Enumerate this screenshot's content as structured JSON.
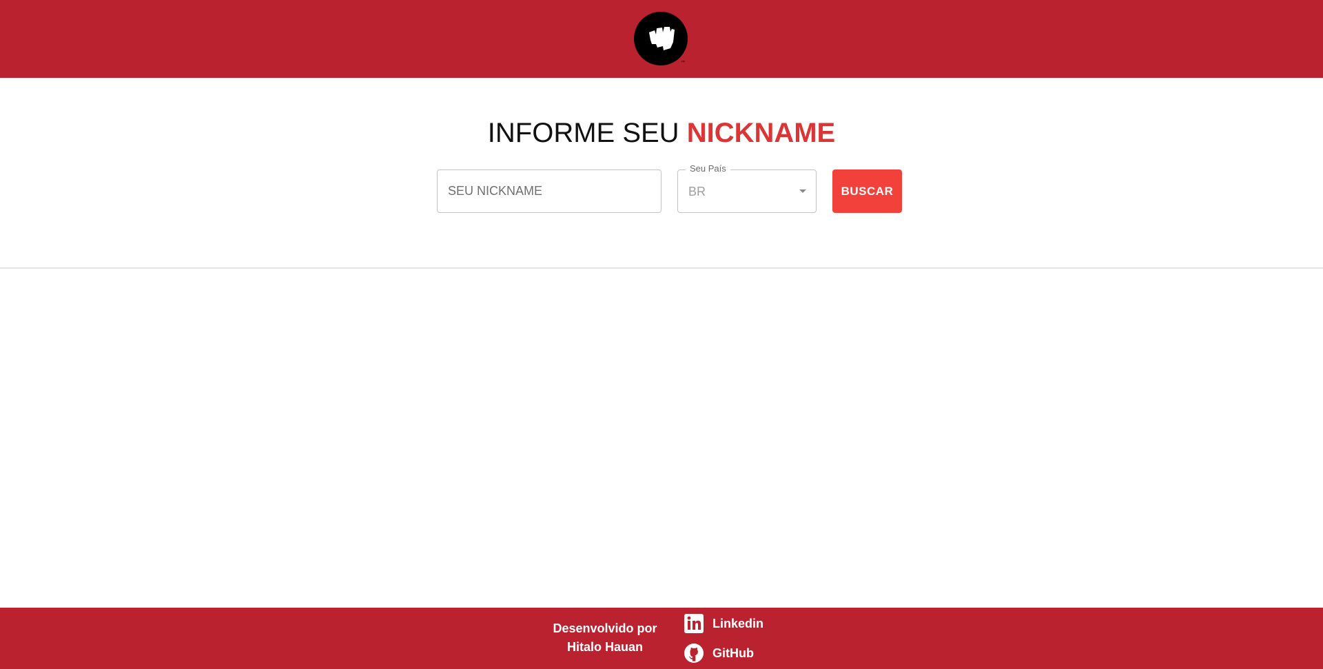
{
  "header": {
    "logo_icon": "fist-logo-icon",
    "logo_mark": "™",
    "brand_color": "#bb2230"
  },
  "search": {
    "title_prefix": "INFORME SEU",
    "title_accent": "NICKNAME",
    "nickname_placeholder": "SEU NICKNAME",
    "nickname_value": "",
    "country_label": "Seu País",
    "country_value": "BR",
    "button_label": "BUSCAR",
    "accent_color": "#dc3535",
    "button_color": "#f2403a"
  },
  "footer": {
    "credit_line1": "Desenvolvido por",
    "credit_line2": "Hitalo Hauan",
    "links": [
      {
        "label": "Linkedin",
        "icon": "linkedin-icon"
      },
      {
        "label": "GitHub",
        "icon": "github-icon"
      }
    ]
  }
}
